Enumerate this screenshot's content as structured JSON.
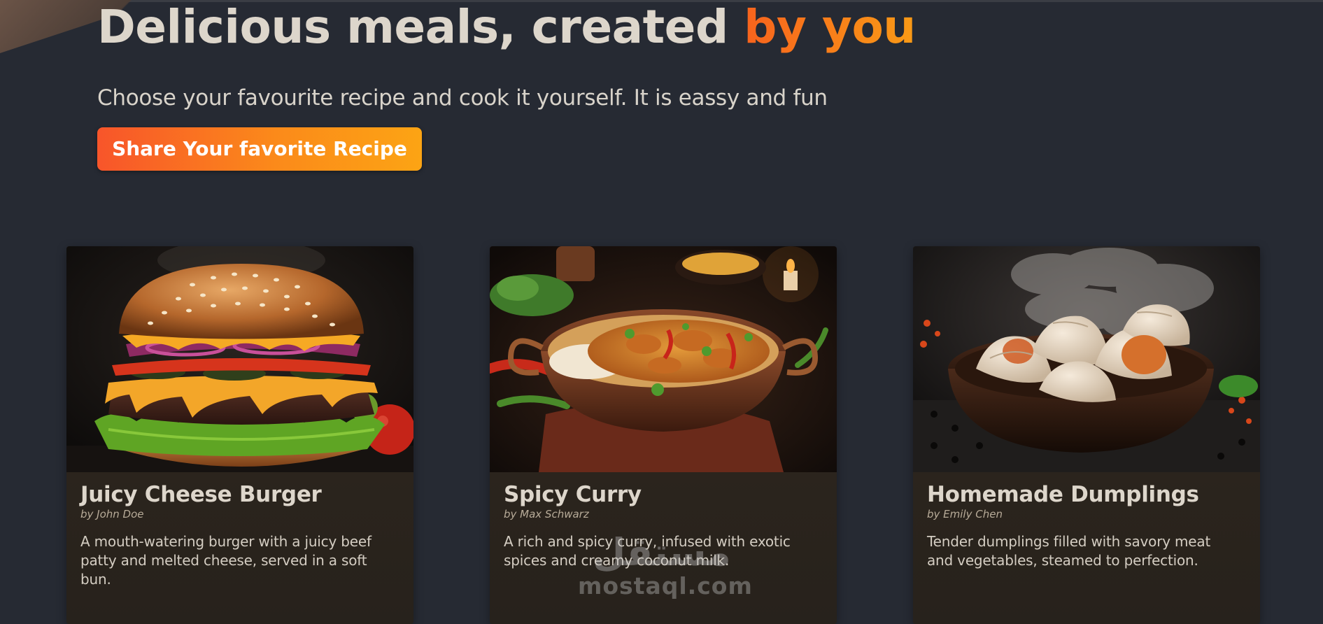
{
  "hero": {
    "title_main": "Delicious meals, created ",
    "title_accent": "by you",
    "subtitle": "Choose your favourite recipe and cook it yourself. It is eassy and fun",
    "cta_label": "Share Your favorite Recipe"
  },
  "meals": [
    {
      "title": "Juicy Cheese Burger",
      "author": "by John Doe",
      "description": "A mouth-watering burger with a juicy beef patty and melted cheese, served in a soft bun."
    },
    {
      "title": "Spicy Curry",
      "author": "by Max Schwarz",
      "description": "A rich and spicy curry, infused with exotic spices and creamy coconut milk."
    },
    {
      "title": "Homemade Dumplings",
      "author": "by Emily Chen",
      "description": "Tender dumplings filled with savory meat and vegetables, steamed to perfection."
    }
  ],
  "watermark": {
    "arabic": "مستقل",
    "latin": "mostaql.com"
  },
  "colors": {
    "background": "#262a33",
    "accent_start": "#f7631d",
    "accent_end": "#fca414",
    "card_body": "#2a2520"
  }
}
